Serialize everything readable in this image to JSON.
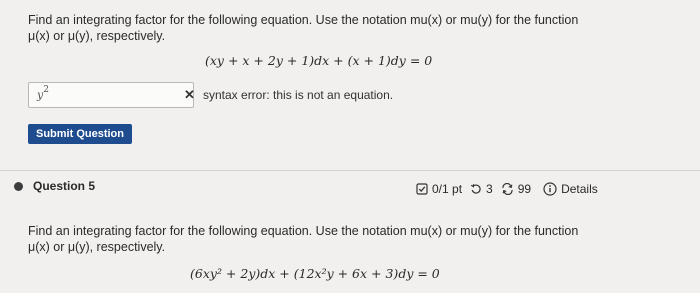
{
  "question1": {
    "prompt_line1": "Find an integrating factor for the following equation. Use the notation mu(x) or mu(y) for the function",
    "prompt_line2": "μ(x) or μ(y), respectively.",
    "equation": "(xy + x + 2y + 1)dx + (x + 1)dy = 0",
    "answer_value_base": "y",
    "answer_value_exp": "2",
    "error_text": "syntax error: this is not an equation.",
    "submit_label": "Submit Question"
  },
  "question5": {
    "title": "Question 5",
    "score": "0/1 pt",
    "retries": "3",
    "attempts": "99",
    "details_label": "Details",
    "prompt_line1": "Find an integrating factor for the following equation. Use the notation mu(x) or mu(y) for the function",
    "prompt_line2": "μ(x) or μ(y), respectively.",
    "equation": "(6xy² + 2y)dx + (12x²y + 6x + 3)dy = 0"
  },
  "icons": {
    "error": "close-icon",
    "score": "check-square-icon",
    "retries": "retry-icon",
    "attempts": "refresh-icon",
    "details": "info-icon"
  }
}
